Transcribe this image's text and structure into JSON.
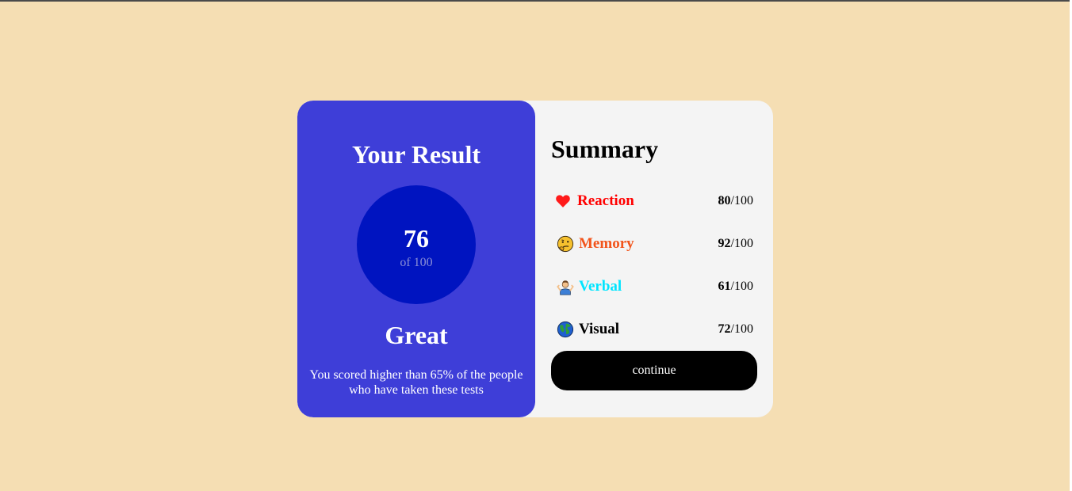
{
  "result": {
    "title": "Your Result",
    "score": "76",
    "score_total": "of 100",
    "grade": "Great",
    "description": "You scored higher than 65% of the people who have taken these tests"
  },
  "summary": {
    "title": "Summary",
    "items": [
      {
        "label": "Reaction",
        "score": "80",
        "max": "/100",
        "color": "#ff0000",
        "icon": "heart-icon"
      },
      {
        "label": "Memory",
        "score": "92",
        "max": "/100",
        "color": "#f2541b",
        "icon": "thinking-face-icon"
      },
      {
        "label": "Verbal",
        "score": "61",
        "max": "/100",
        "color": "#00e5ff",
        "icon": "person-shrugging-icon"
      },
      {
        "label": "Visual",
        "score": "72",
        "max": "/100",
        "color": "#000000",
        "icon": "globe-icon"
      }
    ],
    "continue_label": "continue"
  },
  "colors": {
    "background": "#f5deb3",
    "result_panel": "#3e3ed8",
    "score_circle": "#0014c0",
    "summary_panel": "#f4f4f4",
    "button": "#000000"
  }
}
